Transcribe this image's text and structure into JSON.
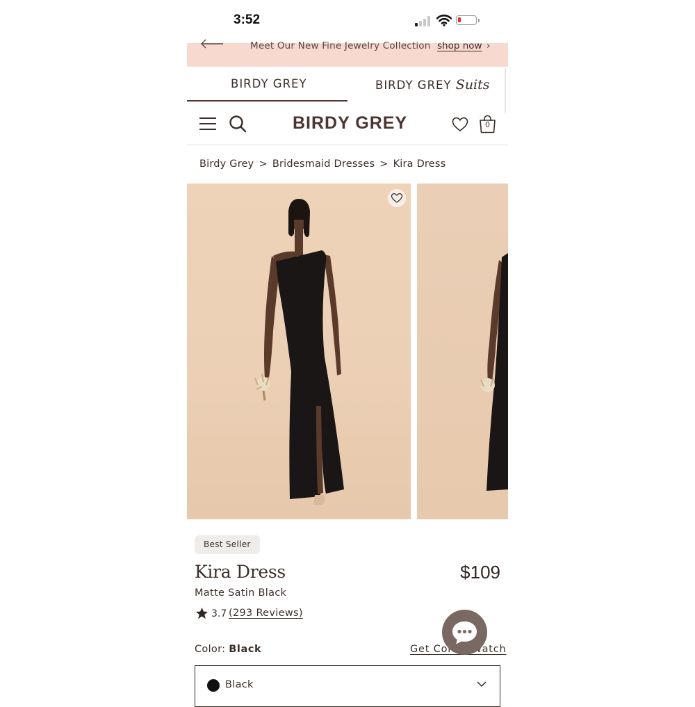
{
  "status_bar": {
    "time": "3:52"
  },
  "promo": {
    "text": "Meet Our New Fine Jewelry Collection",
    "link": "shop now",
    "chevron": "›"
  },
  "brand_tabs": [
    {
      "label": "BIRDY GREY",
      "active": true
    },
    {
      "label": "BIRDY GREY",
      "suffix": "Suits",
      "active": false
    }
  ],
  "header": {
    "logo": "BIRDY GREY",
    "bag_count": "0"
  },
  "breadcrumb": {
    "items": [
      "Birdy Grey",
      "Bridesmaid Dresses",
      "Kira Dress"
    ],
    "separator": ">"
  },
  "product": {
    "badge": "Best Seller",
    "name": "Kira Dress",
    "price": "$109",
    "fabric_color": "Matte Satin Black",
    "rating": "3.7",
    "reviews": "(293 Reviews)",
    "color_label": "Color:",
    "color_value": "Black",
    "swatch_link": "Get Color Swatch",
    "selected_color": "Black"
  },
  "icons": {
    "menu": "menu-icon",
    "search": "search-icon",
    "heart": "heart-icon",
    "bag": "bag-icon",
    "star": "star-icon",
    "chat": "chat-icon",
    "chevron": "chevron-down-icon"
  },
  "colors": {
    "promo_bg": "#f7d9d0",
    "brand": "#4a3530",
    "chat_button": "#7a6863",
    "photo_bg": "#ecd0b5"
  }
}
